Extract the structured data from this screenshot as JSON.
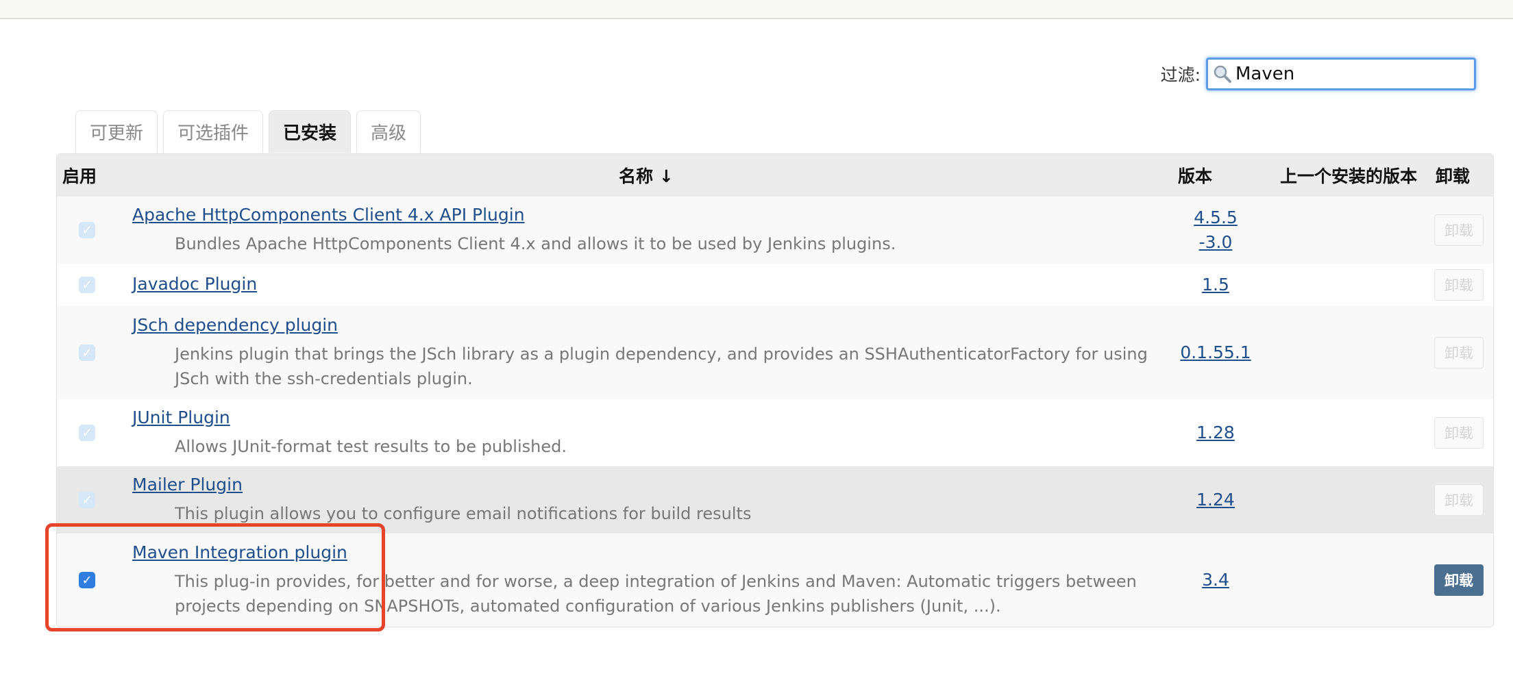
{
  "filter": {
    "label": "过滤:",
    "value": "Maven"
  },
  "tabs": [
    {
      "label": "可更新",
      "active": false
    },
    {
      "label": "可选插件",
      "active": false
    },
    {
      "label": "已安装",
      "active": true
    },
    {
      "label": "高级",
      "active": false
    }
  ],
  "table": {
    "headers": {
      "enable": "启用",
      "name": "名称 ↓",
      "version": "版本",
      "previous_version": "上一个安装的版本",
      "uninstall": "卸载"
    },
    "rows": [
      {
        "name": "Apache HttpComponents Client 4.x API Plugin",
        "description": "Bundles Apache HttpComponents Client 4.x and allows it to be used by Jenkins plugins.",
        "version": "4.5.5-3.0",
        "enabled": true,
        "uninstall_label": "卸载",
        "uninstall_enabled": false
      },
      {
        "name": "Javadoc Plugin",
        "description": "",
        "version": "1.5",
        "enabled": true,
        "uninstall_label": "卸载",
        "uninstall_enabled": false
      },
      {
        "name": "JSch dependency plugin",
        "description": "Jenkins plugin that brings the JSch library as a plugin dependency, and provides an SSHAuthenticatorFactory for using JSch with the ssh-credentials plugin.",
        "version": "0.1.55.1",
        "enabled": true,
        "uninstall_label": "卸载",
        "uninstall_enabled": false
      },
      {
        "name": "JUnit Plugin",
        "description": "Allows JUnit-format test results to be published.",
        "version": "1.28",
        "enabled": true,
        "uninstall_label": "卸载",
        "uninstall_enabled": false
      },
      {
        "name": "Mailer Plugin",
        "description": "This plugin allows you to configure email notifications for build results",
        "version": "1.24",
        "enabled": true,
        "uninstall_label": "卸载",
        "uninstall_enabled": false
      },
      {
        "name": "Maven Integration plugin",
        "description": "This plug-in provides, for better and for worse, a deep integration of Jenkins and Maven: Automatic triggers between projects depending on SNAPSHOTs, automated configuration of various Jenkins publishers (Junit, ...).",
        "version": "3.4",
        "enabled": true,
        "uninstall_label": "卸载",
        "uninstall_enabled": true
      }
    ]
  },
  "colors": {
    "highlight": "#e8432b",
    "link": "#1f4e8c",
    "uninstall_active": "#4a6f8f",
    "checkbox_on": "#2f7de1"
  }
}
